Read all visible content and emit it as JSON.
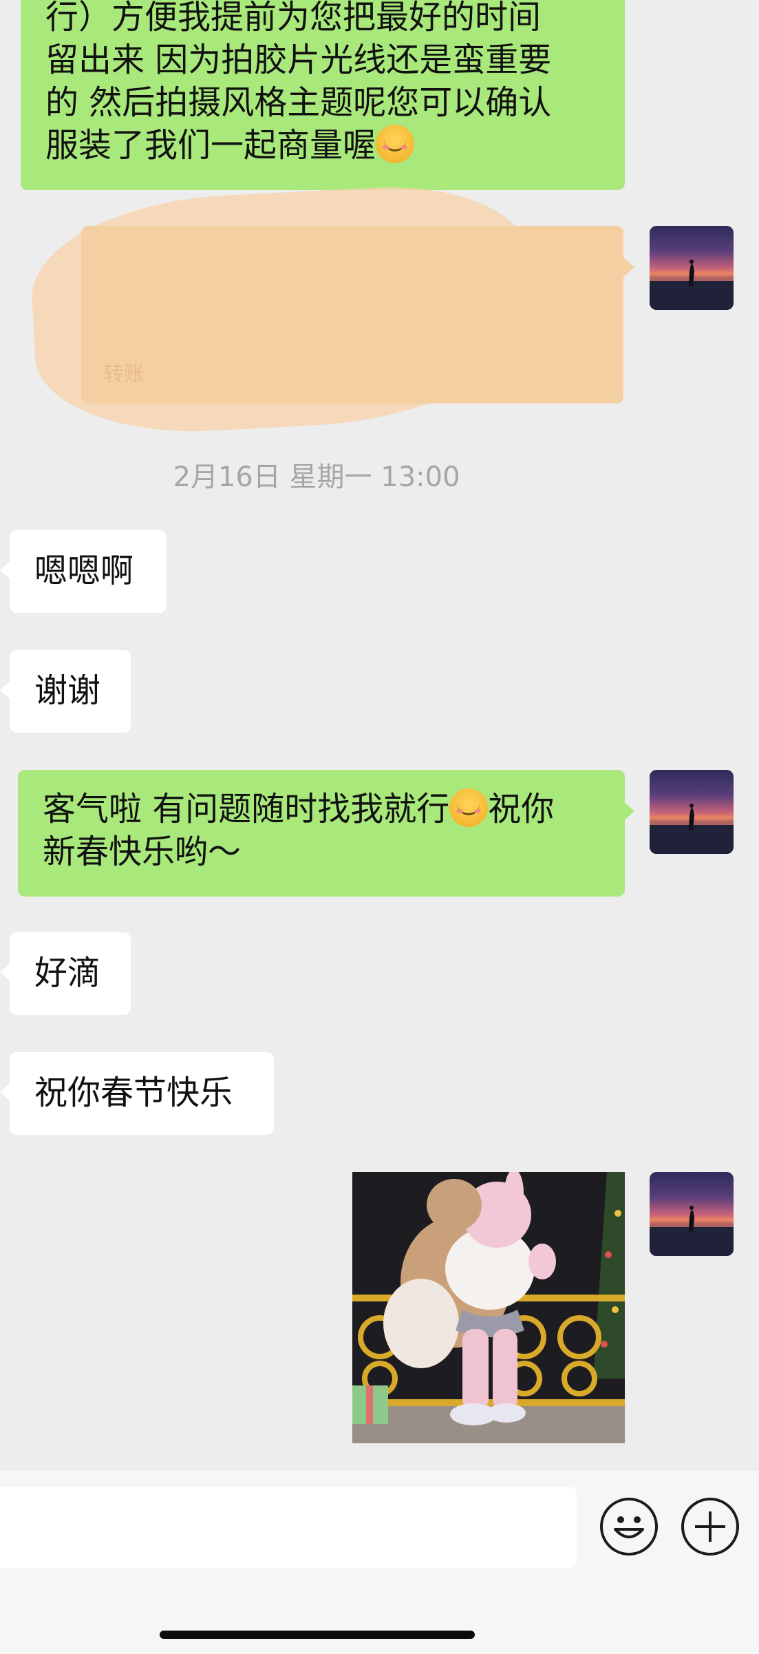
{
  "messages": [
    {
      "id": "m1",
      "direction": "outgoing",
      "lines": [
        "行）方便我提前为您把最好的时间",
        "留出来  因为拍胶片光线还是蛮重要",
        "的  然后拍摄风格主题呢您可以确认",
        "服装了我们一起商量喔"
      ],
      "trailing_emoji": "smiling-face-emoji"
    },
    {
      "id": "m2",
      "direction": "outgoing",
      "type": "transfer",
      "label": "转账",
      "redacted": true
    },
    {
      "id": "m3",
      "direction": "incoming",
      "text": "嗯嗯啊"
    },
    {
      "id": "m4",
      "direction": "incoming",
      "text": "谢谢"
    },
    {
      "id": "m5",
      "direction": "outgoing",
      "line1_before_emoji": "客气啦 有问题随时找我就行",
      "line1_after_emoji": "祝你",
      "line2": "新春快乐哟～"
    },
    {
      "id": "m6",
      "direction": "incoming",
      "text": "好滴"
    },
    {
      "id": "m7",
      "direction": "incoming",
      "text": "祝你春节快乐"
    },
    {
      "id": "m8",
      "direction": "outgoing",
      "type": "sticker",
      "sticker_icon": "dancing-bear-sticker"
    }
  ],
  "timestamp": "2月16日 星期一 13:00",
  "input": {
    "placeholder": "",
    "emoji_button_icon": "smile-face-icon",
    "more_button_icon": "plus-circle-icon"
  },
  "colors": {
    "outgoing_bubble": "#a9e97b",
    "incoming_bubble": "#ffffff",
    "background": "#ededed",
    "timestamp": "#a6a6a6"
  }
}
